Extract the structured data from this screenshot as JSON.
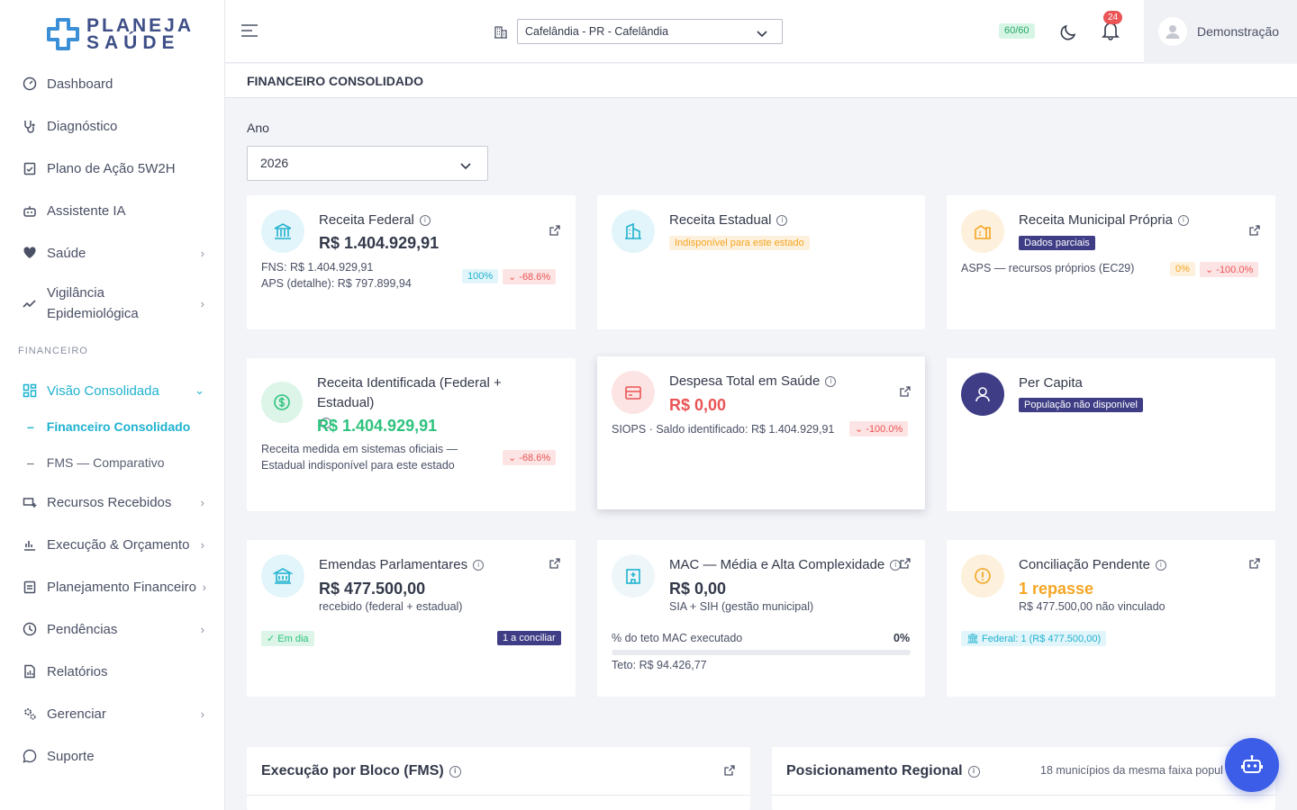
{
  "brand": {
    "line1": "PLANEJA",
    "line2": "SAÚDE"
  },
  "sidebar": {
    "items": [
      {
        "label": "Dashboard",
        "icon": "gauge-icon"
      },
      {
        "label": "Diagnóstico",
        "icon": "stethoscope-icon"
      },
      {
        "label": "Plano de Ação 5W2H",
        "icon": "clipboard-check-icon"
      },
      {
        "label": "Assistente IA",
        "icon": "robot-icon"
      },
      {
        "label": "Saúde",
        "icon": "heart-pulse-icon"
      },
      {
        "label": "Vigilância Epidemiológica",
        "icon": "trend-line-icon"
      }
    ],
    "section": "FINANCEIRO",
    "active": {
      "label": "Visão Consolidada",
      "icon": "dashboard-grid-icon"
    },
    "subitems": [
      {
        "label": "Financeiro Consolidado",
        "active": true
      },
      {
        "label": "FMS — Comparativo",
        "active": false
      }
    ],
    "items2": [
      {
        "label": "Recursos Recebidos",
        "icon": "cash-plus-icon"
      },
      {
        "label": "Execução & Orçamento",
        "icon": "chart-hand-icon"
      },
      {
        "label": "Planejamento Financeiro",
        "icon": "clipboard-list-icon"
      },
      {
        "label": "Pendências",
        "icon": "clock-icon"
      },
      {
        "label": "Relatórios",
        "icon": "report-icon"
      },
      {
        "label": "Gerenciar",
        "icon": "gears-icon"
      },
      {
        "label": "Suporte",
        "icon": "whatsapp-icon"
      }
    ]
  },
  "topbar": {
    "municipality": "Cafelândia - PR - Cafelândia",
    "quota": "60/60",
    "notifications": "24",
    "user": "Demonstração"
  },
  "page": {
    "title": "FINANCEIRO CONSOLIDADO",
    "year_label": "Ano",
    "year_value": "2026"
  },
  "cards": {
    "receita_federal": {
      "title": "Receita Federal",
      "value": "R$ 1.404.929,91",
      "line1": "FNS: R$ 1.404.929,91",
      "line2": "APS (detalhe): R$ 797.899,94",
      "pct": "100%",
      "delta": "-68.6%"
    },
    "receita_estadual": {
      "title": "Receita Estadual",
      "badge": "Indisponível para este estado"
    },
    "receita_municipal": {
      "title": "Receita Municipal Própria",
      "badge": "Dados parciais",
      "line1": "ASPS — recursos próprios (EC29)",
      "pct": "0%",
      "delta": "-100.0%"
    },
    "receita_identificada": {
      "title": "Receita Identificada (Federal + Estadual)",
      "value": "R$ 1.404.929,91",
      "line1": "Receita medida em sistemas oficiais —",
      "line2": "Estadual indisponível para este estado",
      "delta": "-68.6%"
    },
    "despesa_total": {
      "title": "Despesa Total em Saúde",
      "value": "R$ 0,00",
      "line1": "SIOPS · Saldo identificado: R$ 1.404.929,91",
      "delta": "-100.0%"
    },
    "per_capita": {
      "title": "Per Capita",
      "badge": "População não disponível"
    },
    "emendas": {
      "title": "Emendas Parlamentares",
      "value": "R$ 477.500,00",
      "line1": "recebido (federal + estadual)",
      "status": "Em dia",
      "pending": "1 a conciliar"
    },
    "mac": {
      "title": "MAC — Média e Alta Complexidade",
      "value": "R$ 0,00",
      "line1": "SIA + SIH (gestão municipal)",
      "progress_label": "% do teto MAC executado",
      "progress_value": "0%",
      "progress": 0,
      "teto": "Teto: R$ 94.426,77"
    },
    "conciliacao": {
      "title": "Conciliação Pendente",
      "value": "1 repasse",
      "line1": "R$ 477.500,00 não vinculado",
      "badge": "Federal: 1 (R$ 477.500,00)"
    }
  },
  "bottom": {
    "left_title": "Execução por Bloco (FMS)",
    "right_title": "Posicionamento Regional",
    "right_note": "18 municípios da mesma faixa popul"
  },
  "colors": {
    "accent": "#1fb2cf",
    "green": "#2ec27e",
    "red": "#ea5455",
    "orange": "#f5a623",
    "purple": "#3f3d86",
    "brand": "#3e4f87"
  }
}
